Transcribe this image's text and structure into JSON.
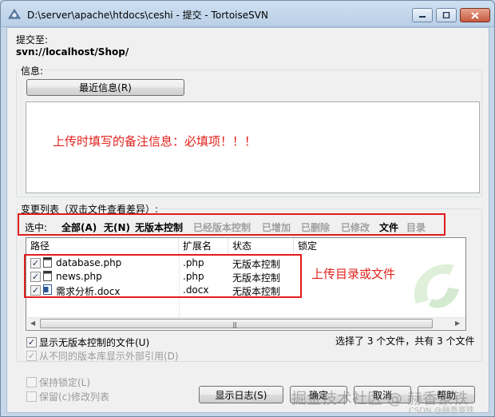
{
  "window": {
    "title": "D:\\server\\apache\\htdocs\\ceshi - 提交 - TortoiseSVN"
  },
  "commit_to": {
    "label": "提交至:",
    "url": "svn://localhost/Shop/"
  },
  "message": {
    "group_label": "信息:",
    "recent_button": "最近信息(R)",
    "text": "上传时填写的备注信息：必填项！！！"
  },
  "changes": {
    "group_label": "变更列表（双击文件查看差异）:",
    "filter_label": "选中:",
    "filters": [
      {
        "label": "全部(A)",
        "enabled": true
      },
      {
        "label": "无(N)",
        "enabled": true
      },
      {
        "label": "无版本控制",
        "enabled": true
      },
      {
        "label": "已经版本控制",
        "enabled": false
      },
      {
        "label": "已增加",
        "enabled": false
      },
      {
        "label": "已删除",
        "enabled": false
      },
      {
        "label": "已修改",
        "enabled": false
      },
      {
        "label": "文件",
        "enabled": true
      },
      {
        "label": "目录",
        "enabled": false
      }
    ],
    "columns": [
      "路径",
      "扩展名",
      "状态",
      "锁定"
    ],
    "rows": [
      {
        "path": "database.php",
        "ext": ".php",
        "status": "无版本控制",
        "lock": ""
      },
      {
        "path": "news.php",
        "ext": ".php",
        "status": "无版本控制",
        "lock": ""
      },
      {
        "path": "需求分析.docx",
        "ext": ".docx",
        "status": "无版本控制",
        "lock": ""
      }
    ],
    "annotation": "上传目录或文件",
    "selection_summary": "选择了 3 个文件，共有 3 个文件"
  },
  "options": {
    "show_unversioned": "显示无版本控制的文件(U)",
    "show_externals": "从不同的版本库显示外部引用(D)",
    "keep_locks": "保持锁定(L)",
    "keep_changelists": "保留(c)修改列表"
  },
  "buttons": {
    "show_log": "显示日志(S)",
    "ok": "确定",
    "cancel": "取消",
    "help": "帮助"
  },
  "watermark": {
    "text": "掘金技术社区 @ 赫香豪铁",
    "small": "CSDN @赫香豪铁"
  },
  "colors": {
    "highlight": "#e21c1c",
    "note_text": "#e0221c"
  }
}
